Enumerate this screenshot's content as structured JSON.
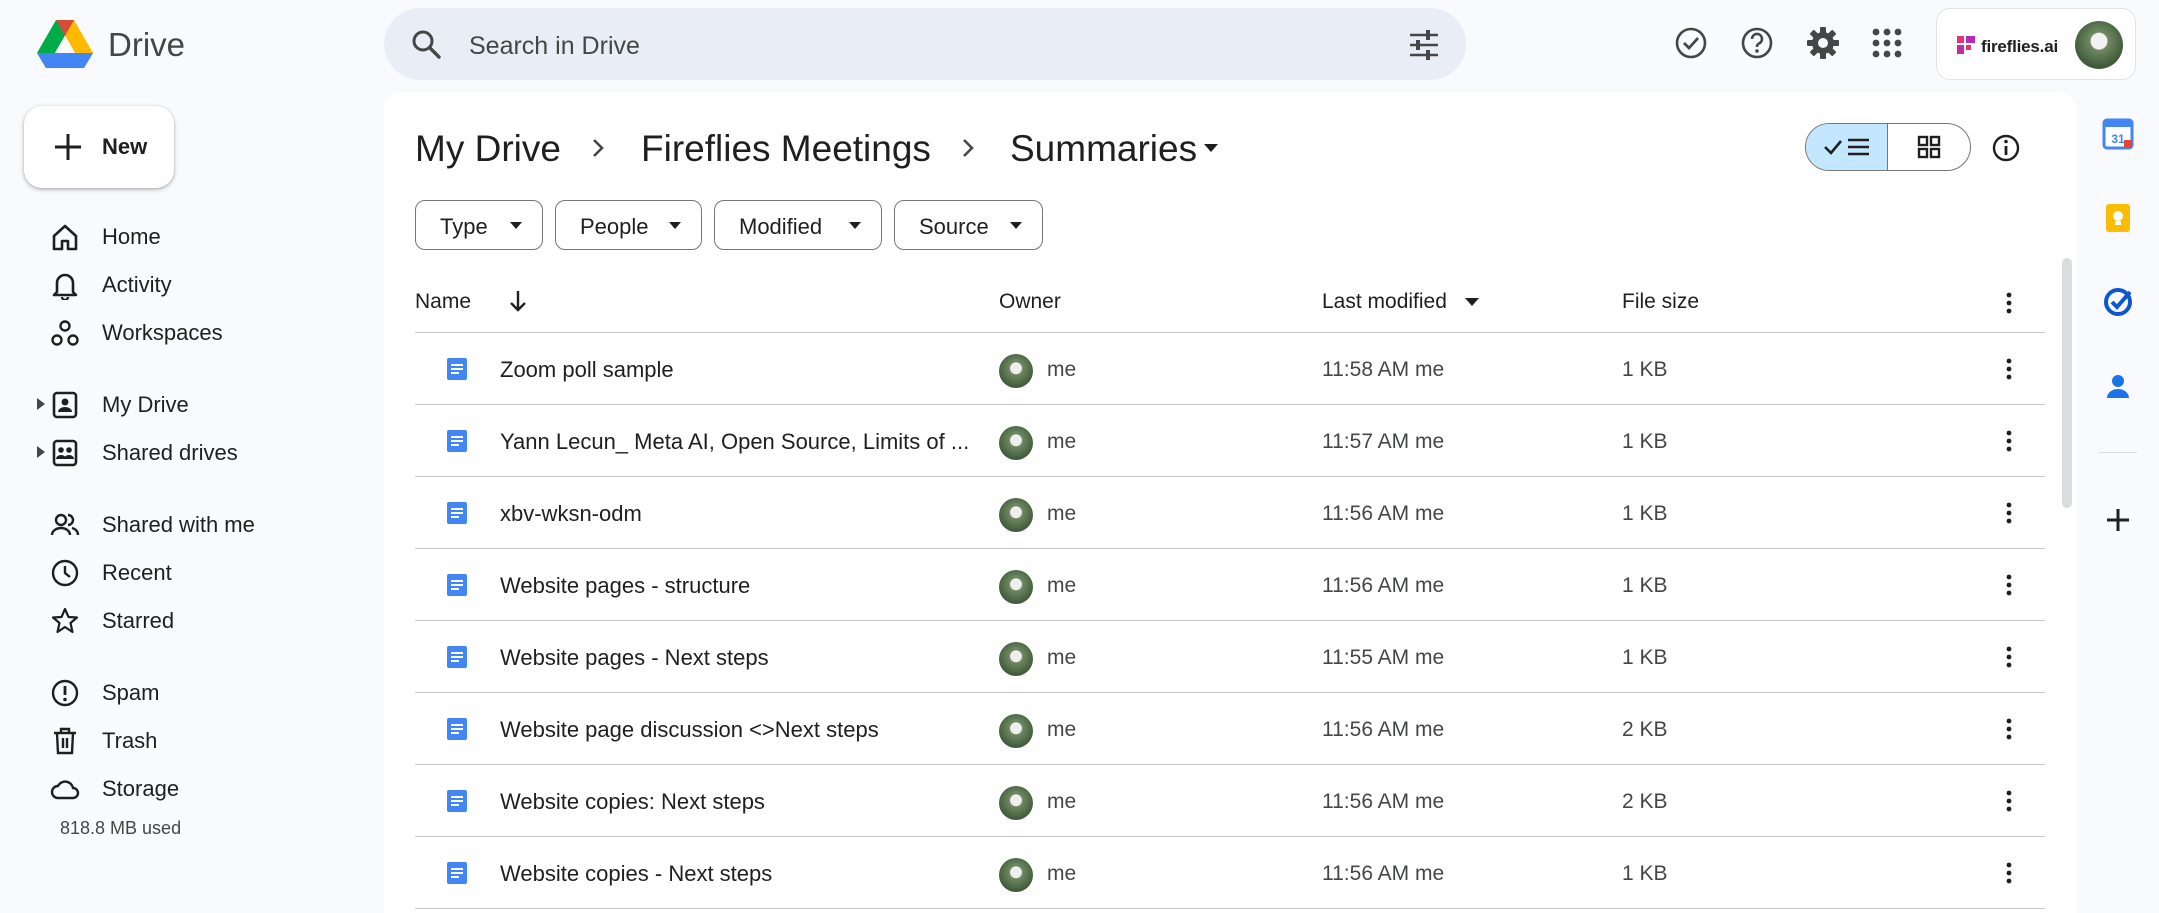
{
  "app": {
    "name": "Drive"
  },
  "search": {
    "placeholder": "Search in Drive"
  },
  "account": {
    "brand_label": "fireflies.ai"
  },
  "sidebar": {
    "new_label": "New",
    "items": [
      {
        "label": "Home",
        "icon": "home-icon"
      },
      {
        "label": "Activity",
        "icon": "bell-icon"
      },
      {
        "label": "Workspaces",
        "icon": "workspaces-icon"
      },
      {
        "label": "My Drive",
        "icon": "my-drive-icon"
      },
      {
        "label": "Shared drives",
        "icon": "shared-drives-icon"
      },
      {
        "label": "Shared with me",
        "icon": "people-icon"
      },
      {
        "label": "Recent",
        "icon": "clock-icon"
      },
      {
        "label": "Starred",
        "icon": "star-icon"
      },
      {
        "label": "Spam",
        "icon": "spam-icon"
      },
      {
        "label": "Trash",
        "icon": "trash-icon"
      },
      {
        "label": "Storage",
        "icon": "cloud-icon"
      }
    ],
    "storage_used": "818.8 MB used"
  },
  "breadcrumb": {
    "items": [
      "My Drive",
      "Fireflies Meetings",
      "Summaries"
    ]
  },
  "filters": [
    "Type",
    "People",
    "Modified",
    "Source"
  ],
  "table": {
    "headers": {
      "name": "Name",
      "owner": "Owner",
      "modified": "Last modified",
      "size": "File size"
    },
    "rows": [
      {
        "name": "Zoom poll sample",
        "owner": "me",
        "modified": "11:58 AM  me",
        "size": "1 KB"
      },
      {
        "name": "Yann Lecun_ Meta AI, Open Source, Limits of ...",
        "owner": "me",
        "modified": "11:57 AM  me",
        "size": "1 KB"
      },
      {
        "name": "xbv-wksn-odm",
        "owner": "me",
        "modified": "11:56 AM  me",
        "size": "1 KB"
      },
      {
        "name": "Website pages - structure",
        "owner": "me",
        "modified": "11:56 AM  me",
        "size": "1 KB"
      },
      {
        "name": "Website pages - Next steps",
        "owner": "me",
        "modified": "11:55 AM  me",
        "size": "1 KB"
      },
      {
        "name": "Website page discussion <>Next steps",
        "owner": "me",
        "modified": "11:56 AM  me",
        "size": "2 KB"
      },
      {
        "name": "Website copies: Next steps",
        "owner": "me",
        "modified": "11:56 AM  me",
        "size": "2 KB"
      },
      {
        "name": "Website copies - Next steps",
        "owner": "me",
        "modified": "11:56 AM  me",
        "size": "1 KB"
      }
    ]
  },
  "side_panel": {
    "calendar_day": "31"
  },
  "colors": {
    "accent": "#0b57d0",
    "selected": "#c2e7ff",
    "doc_blue": "#4285f4"
  }
}
